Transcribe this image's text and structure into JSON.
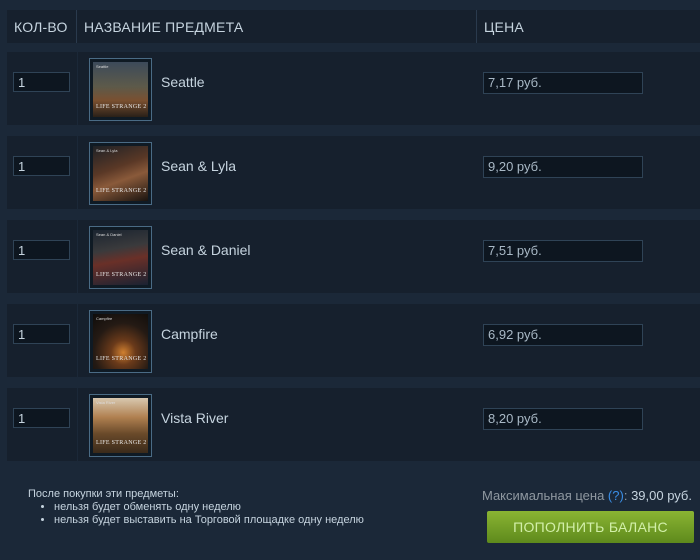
{
  "header": {
    "qty": "КОЛ-ВО",
    "name": "НАЗВАНИЕ ПРЕДМЕТА",
    "price": "ЦЕНА"
  },
  "items": [
    {
      "qty": "1",
      "name": "Seattle",
      "price": "7,17 руб.",
      "caption": "Seattle"
    },
    {
      "qty": "1",
      "name": "Sean & Lyla",
      "price": "9,20 руб.",
      "caption": "Sean & Lyla"
    },
    {
      "qty": "1",
      "name": "Sean & Daniel",
      "price": "7,51 руб.",
      "caption": "Sean & Daniel"
    },
    {
      "qty": "1",
      "name": "Campfire",
      "price": "6,92 руб.",
      "caption": "Campfire"
    },
    {
      "qty": "1",
      "name": "Vista River",
      "price": "8,20 руб.",
      "caption": "Vista River"
    }
  ],
  "thumb_logo": "LIFE STRANGE 2",
  "notes": {
    "title": "После покупки эти предметы:",
    "lines": [
      "нельзя будет обменять одну неделю",
      "нельзя будет выставить на Торговой площадке одну неделю"
    ]
  },
  "summary": {
    "label": "Максимальная цена",
    "help": "(?)",
    "colon": ":",
    "value": "39,00 руб."
  },
  "button": {
    "label": "ПОПОЛНИТЬ БАЛАНС"
  },
  "colors": {
    "background": "#1b2838",
    "row": "#16202d",
    "button_top": "#8ab433",
    "button_bottom": "#5e8a1c",
    "link": "#3a8ee6"
  }
}
